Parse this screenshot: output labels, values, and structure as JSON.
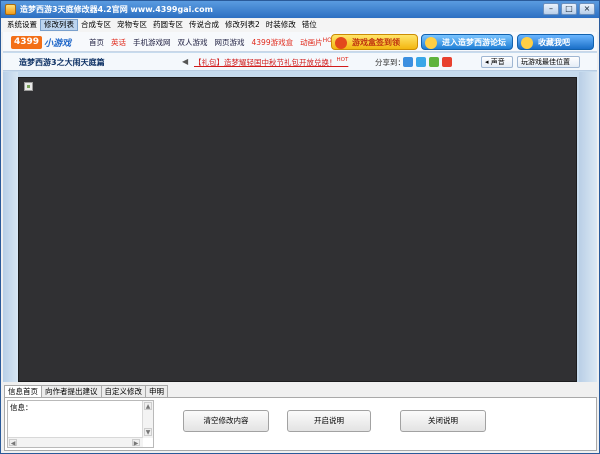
{
  "window": {
    "title": "造梦西游3天庭修改器4.2官网 www.4399gai.com",
    "controls": {
      "minimize": "–",
      "maximize": "□",
      "close": "×"
    }
  },
  "menu": {
    "items": [
      "系统设置",
      "修改列表",
      "合成专区",
      "宠物专区",
      "药圆专区",
      "传说合成",
      "修改列表2",
      "时装修改",
      "错位"
    ],
    "active_index": 1
  },
  "site": {
    "logo_num": "4399",
    "logo_text": "小游戏",
    "nav": [
      "首页",
      "英话",
      "手机游戏网",
      "双人游戏",
      "网页游戏",
      "4399游戏盒",
      "动画片"
    ],
    "nav_hot": "HOT",
    "promo_sign": "游戏盒签到领",
    "promo_forum": "进入造梦西游论坛",
    "promo_fav": "收藏我吧"
  },
  "game_bar": {
    "title": "造梦西游3之大闹天庭篇",
    "gift_link": "【礼包】造梦耀轻国中秋节礼包开放兑换！",
    "hot": "HOT",
    "share_label": "分享到：",
    "sound_button": "声音",
    "best_position_button": "玩游戏最佳位置"
  },
  "bottom": {
    "tabs": [
      "信息首页",
      "向作者提出建议",
      "自定义修改",
      "申明"
    ],
    "active_tab": 0,
    "info_label": "信息：",
    "buttons": {
      "clear": "清空修改内容",
      "open_info": "开启说明",
      "close_info": "关闭说明"
    }
  },
  "colors": {
    "title_bar": "#2c6fc2",
    "game_canvas": "#303033",
    "brand_orange": "#f36f17",
    "link_red": "#d11b1b"
  }
}
